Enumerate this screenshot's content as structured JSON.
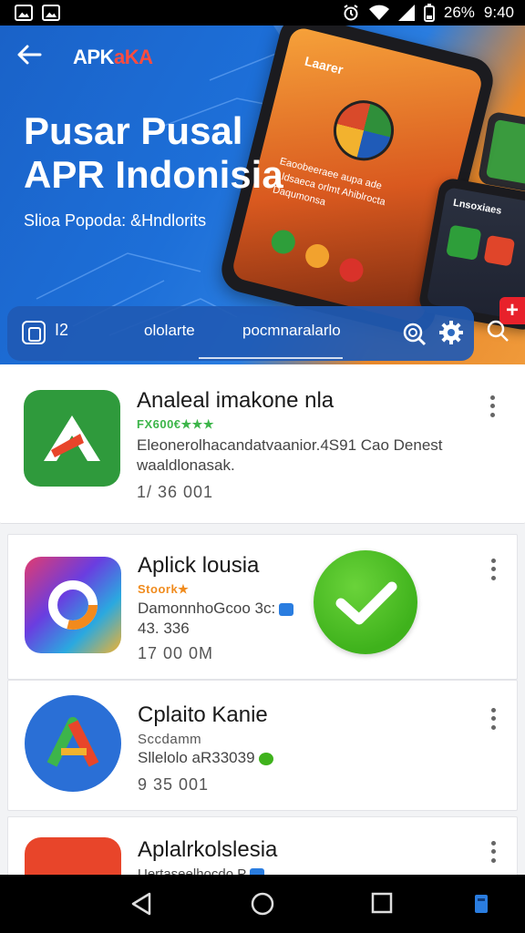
{
  "status": {
    "battery": "26%",
    "time": "9:40"
  },
  "header": {
    "brand_prefix": "APK",
    "brand_suffix": "aKA"
  },
  "hero": {
    "title": "Pusar Pusal APR Indonisia",
    "subtitle": "Slioa Popoda: &Hndlorits",
    "phone_label": "Laarer",
    "phone_text": "Eaoobeeraee aupa ade Lldsaeca orlmt Ahiblrocta Daqumonsa",
    "phone_small_title": "Lnsoxiaes"
  },
  "tabs": {
    "left_label": "I2",
    "items": [
      {
        "label": "ololarte"
      },
      {
        "label": "pocmnaralarlo"
      }
    ]
  },
  "apps": [
    {
      "title": "Analeal imakone nla",
      "rating": "FX600€★★★",
      "rating_color": "#3db54a",
      "desc_line1": "Eleonerolhacandatvaanior.4S91  Cao Denest",
      "desc_line2": "waaldlonasak.",
      "meta": "1/  36  001"
    },
    {
      "title": "Aplick lousia",
      "rating": "Stoork★",
      "rating_color": "#f08b1d",
      "desc_line1": "DamonnhoGcoo 3c:",
      "desc_line2": "43. 336",
      "meta": "17  00  0M"
    },
    {
      "title": "Cplaito Kanie",
      "rating": "Sccdamm",
      "rating_color": "#555555",
      "desc_line1": "Sllelolo aR33039",
      "desc_line2": "",
      "meta": "9  35  001"
    },
    {
      "title": "Aplalrkolslesia",
      "rating": "",
      "rating_color": "#555555",
      "desc_line1": "Uertaseelhocdo P",
      "desc_line2": "",
      "meta": ""
    }
  ],
  "colors": {
    "accent_green": "#3fb21c",
    "accent_red": "#e8212b",
    "hero_blue": "#1d6fd8",
    "hero_orange": "#f09a3a"
  }
}
